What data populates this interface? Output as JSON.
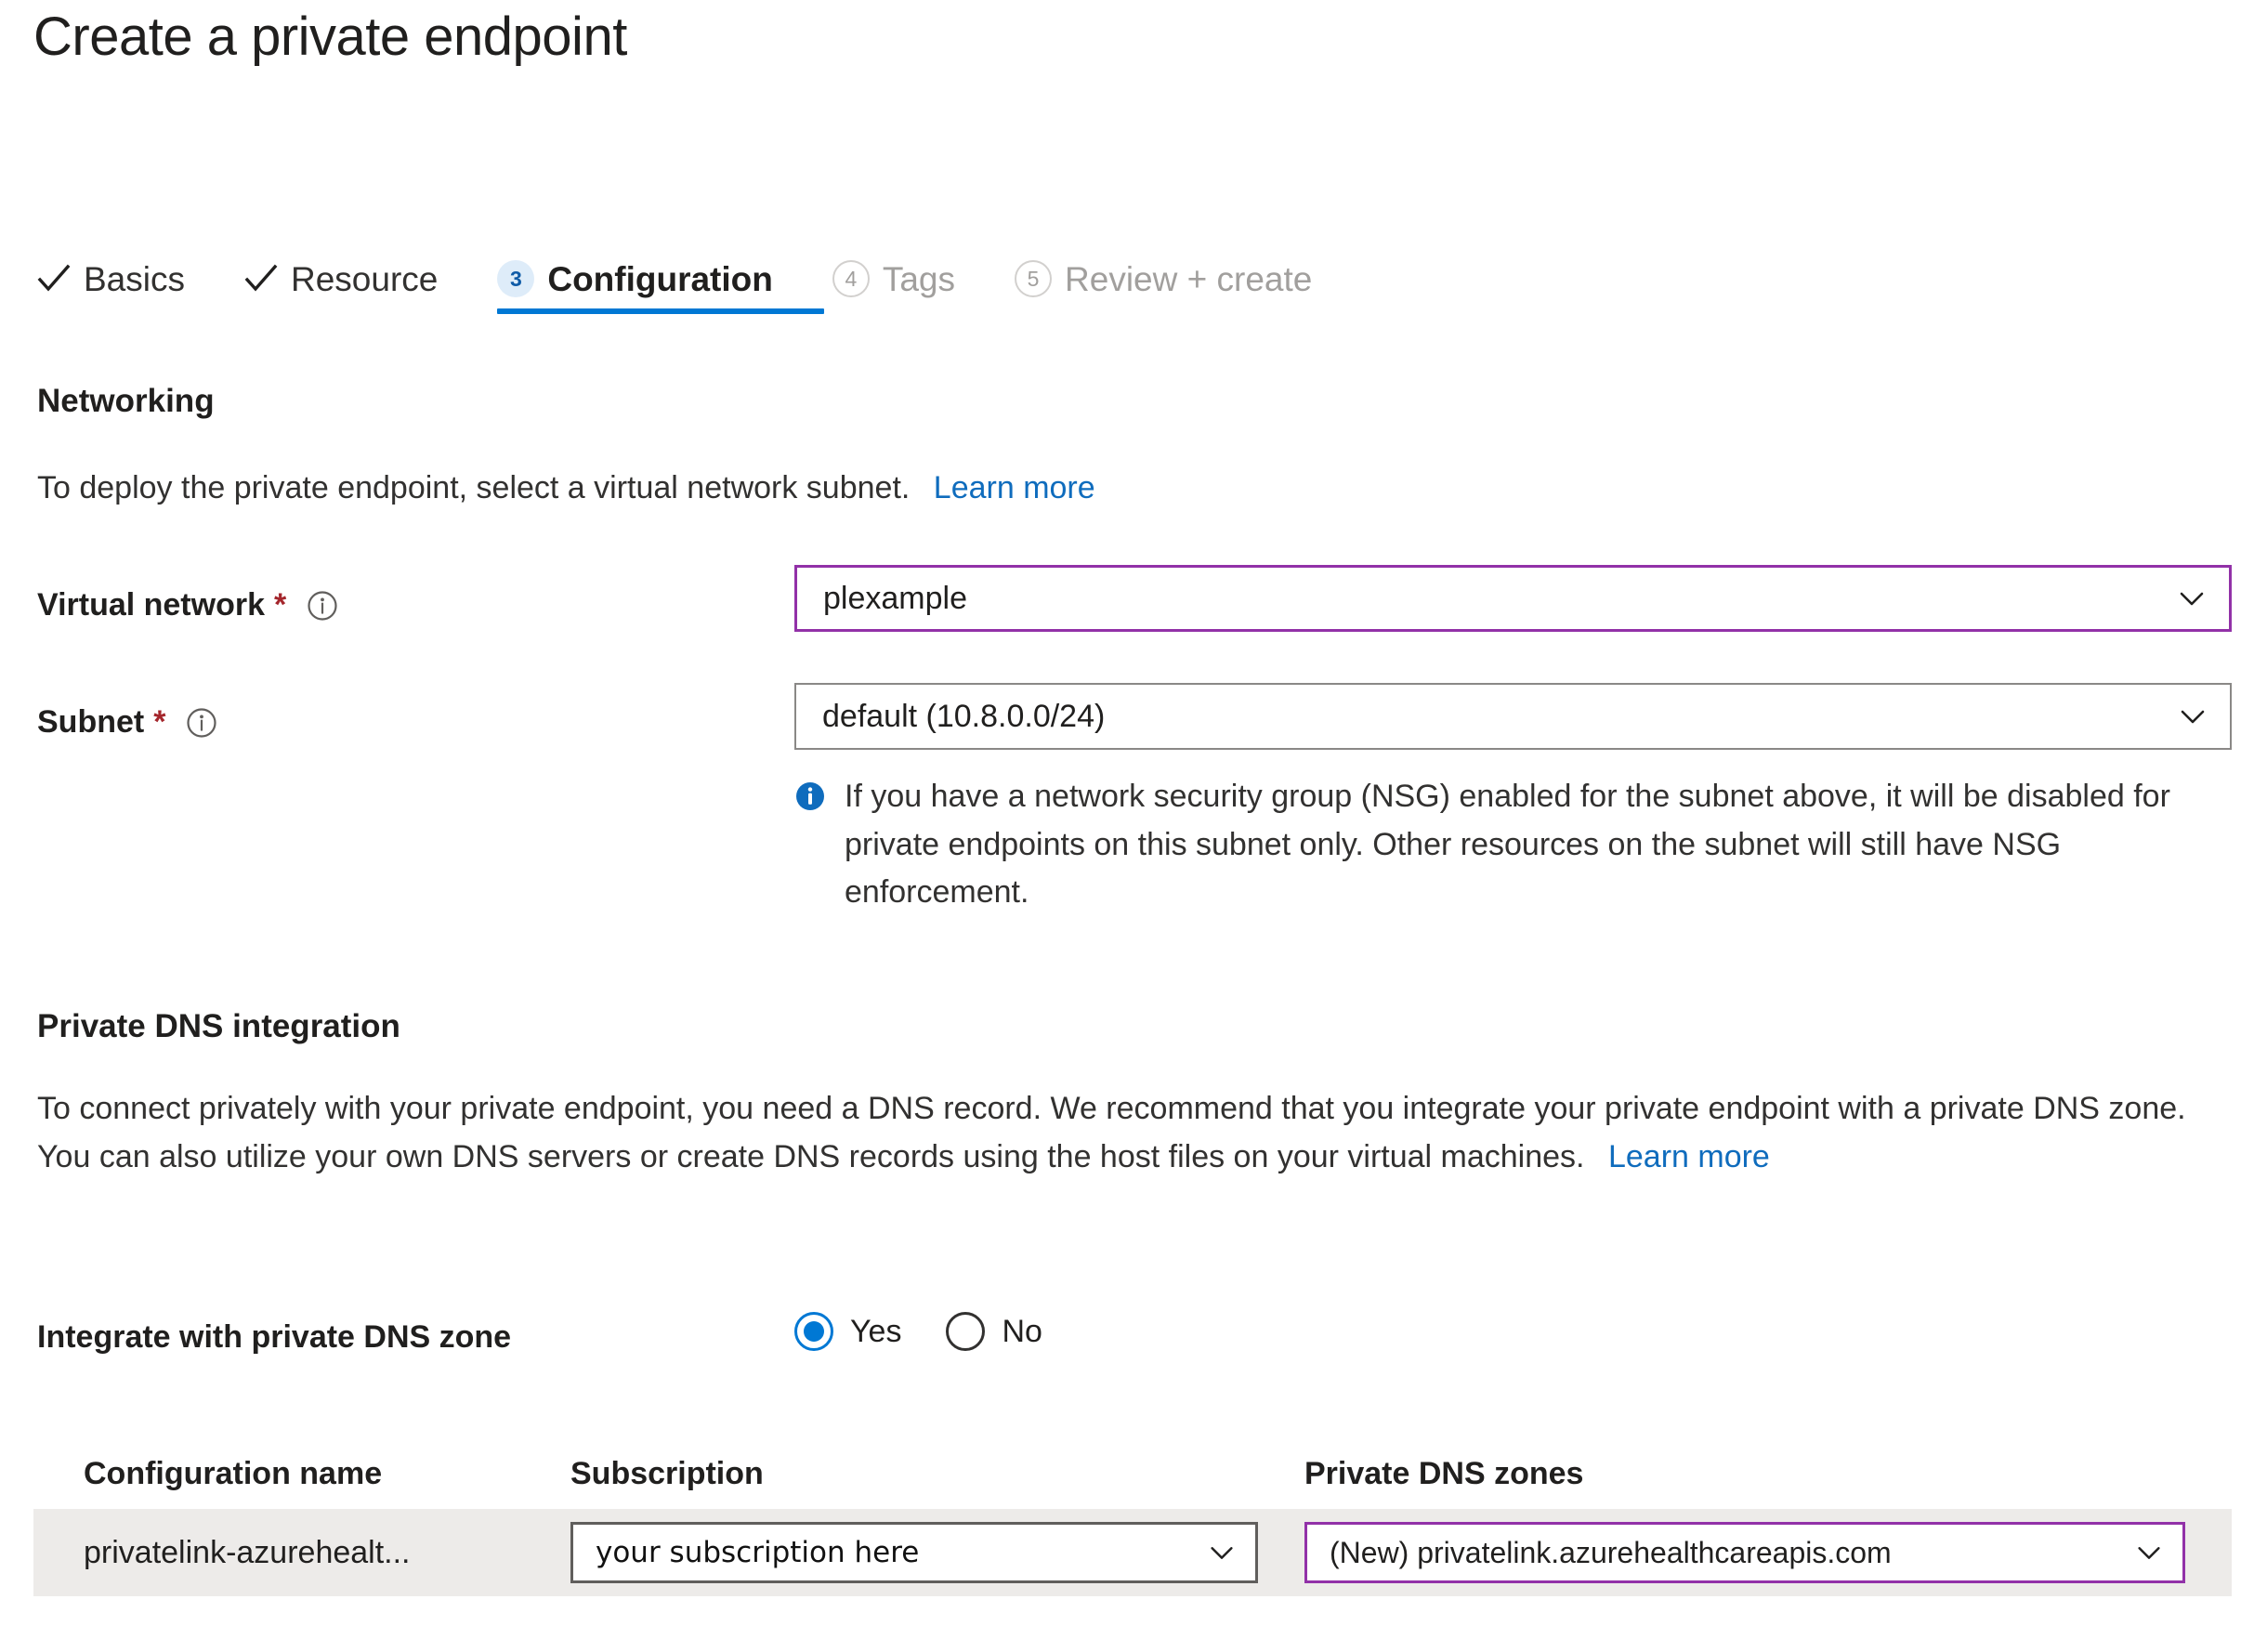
{
  "header": {
    "title": "Create a private endpoint"
  },
  "wizard": {
    "steps": [
      {
        "label": "Basics",
        "state": "done",
        "icon": "check-icon"
      },
      {
        "label": "Resource",
        "state": "done",
        "icon": "check-icon"
      },
      {
        "label": "Configuration",
        "state": "current",
        "number": "3"
      },
      {
        "label": "Tags",
        "state": "pending",
        "number": "4"
      },
      {
        "label": "Review + create",
        "state": "pending",
        "number": "5"
      }
    ]
  },
  "networking": {
    "heading": "Networking",
    "description": "To deploy the private endpoint, select a virtual network subnet.",
    "learn_more": "Learn more",
    "virtual_network": {
      "label": "Virtual network",
      "required_marker": "*",
      "info_icon": "info-circle-icon",
      "value": "plexample",
      "border_color": "#9231a8"
    },
    "subnet": {
      "label": "Subnet",
      "required_marker": "*",
      "info_icon": "info-circle-icon",
      "value": "default (10.8.0.0/24)",
      "border_color": "#8a8886"
    },
    "nsg_notice": {
      "icon": "info-filled-icon",
      "icon_color": "#0078d4",
      "text": "If you have a network security group (NSG) enabled for the subnet above, it will be disabled for private endpoints on this subnet only. Other resources on the subnet will still have NSG enforcement."
    }
  },
  "private_dns": {
    "heading": "Private DNS integration",
    "description": "To connect privately with your private endpoint, you need a DNS record. We recommend that you integrate your private endpoint with a private DNS zone. You can also utilize your own DNS servers or create DNS records using the host files on your virtual machines.",
    "learn_more": "Learn more",
    "integrate": {
      "label": "Integrate with private DNS zone",
      "selected": "Yes",
      "options": [
        {
          "label": "Yes",
          "selected": true
        },
        {
          "label": "No",
          "selected": false
        }
      ]
    },
    "table": {
      "columns": [
        "Configuration name",
        "Subscription",
        "Private DNS zones"
      ],
      "rows": [
        {
          "configuration_name": "privatelink-azurehealt...",
          "subscription": "your subscription here",
          "private_dns_zone": "(New) privatelink.azurehealthcareapis.com"
        }
      ]
    }
  },
  "colors": {
    "accent": "#0078d4",
    "link": "#0f6cbd",
    "required": "#a4262c",
    "focus_border": "#9231a8",
    "row_bg": "#edebe9"
  }
}
